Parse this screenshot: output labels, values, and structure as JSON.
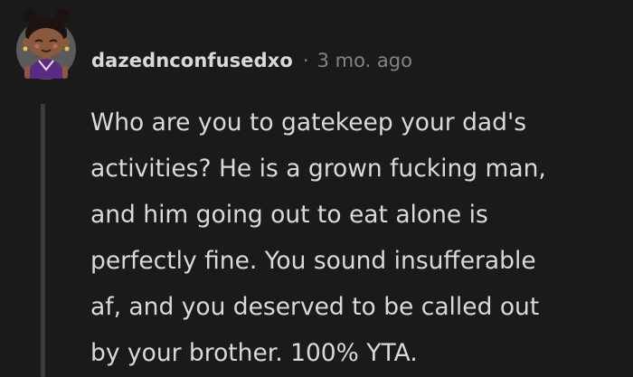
{
  "comment": {
    "username": "dazednconfusedxo",
    "separator": "·",
    "timestamp": "3 mo. ago",
    "body": "Who are you to gatekeep your dad's\nactivities? He is a grown fucking man,\nand him going out to eat alone is\nperfectly fine. You sound insufferable\naf, and you deserved to be called out\nby your brother. 100% YTA."
  },
  "colors": {
    "background": "#1a1a1b",
    "text": "#d7dadc",
    "meta": "#818384",
    "thread_line": "#3b3b3d"
  },
  "icons": {
    "avatar": "snoo-avatar-icon"
  }
}
